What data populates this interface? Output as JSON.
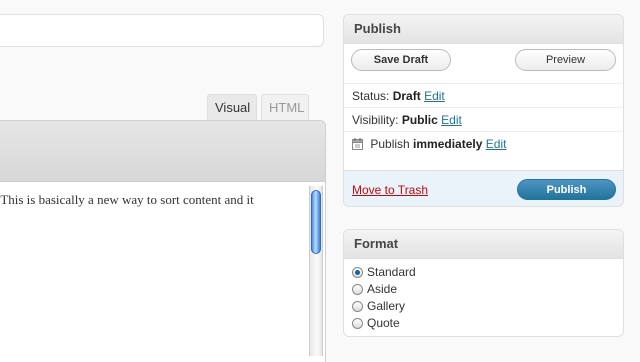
{
  "editor": {
    "tabs": [
      {
        "label": "Visual"
      },
      {
        "label": "HTML"
      }
    ],
    "content_text": "s. This is basically a new way to sort content and it"
  },
  "publish": {
    "title": "Publish",
    "save_draft_label": "Save Draft",
    "preview_label": "Preview",
    "status_label": "Status:",
    "status_value": "Draft",
    "visibility_label": "Visibility:",
    "visibility_value": "Public",
    "schedule_label": "Publish",
    "schedule_value": "immediately",
    "edit_label": "Edit",
    "trash_label": "Move to Trash",
    "publish_label": "Publish",
    "colors": {
      "accent": "#21759b",
      "trash": "#bc0b0b"
    }
  },
  "format": {
    "title": "Format",
    "options": [
      {
        "label": "Standard",
        "selected": true
      },
      {
        "label": "Aside",
        "selected": false
      },
      {
        "label": "Gallery",
        "selected": false
      },
      {
        "label": "Quote",
        "selected": false
      }
    ]
  }
}
